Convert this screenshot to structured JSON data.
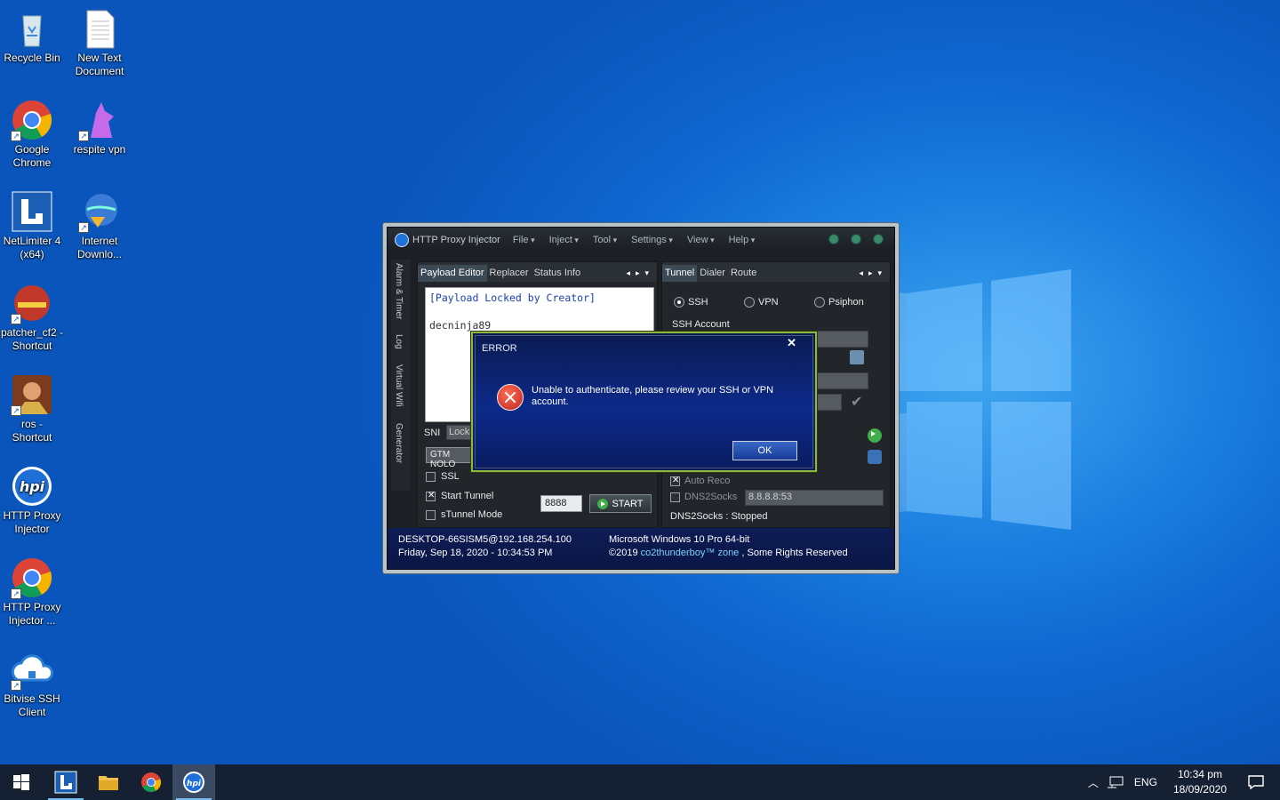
{
  "desktop_icons": [
    {
      "label": "Recycle Bin",
      "icon": "recycle-bin-icon"
    },
    {
      "label": "New Text Document",
      "icon": "text-document-icon"
    },
    {
      "label": "Google Chrome",
      "icon": "chrome-icon"
    },
    {
      "label": "respite vpn",
      "icon": "respite-vpn-icon"
    },
    {
      "label": "NetLimiter 4 (x64)",
      "icon": "netlimiter-icon"
    },
    {
      "label": "Internet Downlo...",
      "icon": "internet-download-manager-icon"
    },
    {
      "label": "patcher_cf2 - Shortcut",
      "icon": "patcher-icon"
    },
    {
      "label": "ros - Shortcut",
      "icon": "ros-icon"
    },
    {
      "label": "HTTP Proxy Injector",
      "icon": "hpi-icon"
    },
    {
      "label": "HTTP Proxy Injector ...",
      "icon": "chrome-icon"
    },
    {
      "label": "Bitvise SSH Client",
      "icon": "bitvise-icon"
    }
  ],
  "app": {
    "title": "HTTP Proxy Injector",
    "menu": [
      "File",
      "Inject",
      "Tool",
      "Settings",
      "View",
      "Help"
    ],
    "side_tabs": [
      "Alarm & Timer",
      "Log",
      "Virtual Wifi",
      "Generator"
    ],
    "left_tabs": [
      "Payload Editor",
      "Replacer",
      "Status Info"
    ],
    "payload_line1": "[Payload Locked by Creator]",
    "payload_line2": "decninja89",
    "sni_label": "SNI",
    "sni_value": "Locke",
    "gtm_value": "GTM NOLO",
    "ssl_label": "SSL",
    "start_tunnel_label": "Start Tunnel",
    "stunnel_label": "sTunnel Mode",
    "port_value": "8888",
    "start_button": "START",
    "right_tabs": [
      "Tunnel",
      "Dialer",
      "Route"
    ],
    "radio_ssh": "SSH",
    "radio_vpn": "VPN",
    "radio_psiphon": "Psiphon",
    "ssh_account_label": "SSH Account",
    "auto_reco_label": "Auto Reco",
    "dns2socks_label": "DNS2Socks",
    "dns_value": "8.8.8.8:53",
    "dns_status": "DNS2Socks : Stopped",
    "footer_host": "DESKTOP-66SISM5@192.168.254.100",
    "footer_date": "Friday, Sep 18, 2020 - 10:34:53 PM",
    "footer_os": "Microsoft Windows 10 Pro 64-bit",
    "footer_copy_pre": "©2019",
    "footer_copy_link": "co2thunderboy™ zone",
    "footer_copy_post": ", Some Rights Reserved"
  },
  "dialog": {
    "title": "ERROR",
    "message": "Unable to authenticate, please review your SSH or VPN account.",
    "ok": "OK"
  },
  "taskbar": {
    "apps": [
      "start-icon",
      "netlimiter-icon",
      "file-explorer-icon",
      "chrome-icon",
      "hpi-icon"
    ],
    "lang": "ENG",
    "time": "10:34 pm",
    "date": "18/09/2020"
  },
  "colors": {
    "accent": "#76b9ed",
    "dialog_border": "#8fb83a",
    "link": "#7fd0ff"
  }
}
